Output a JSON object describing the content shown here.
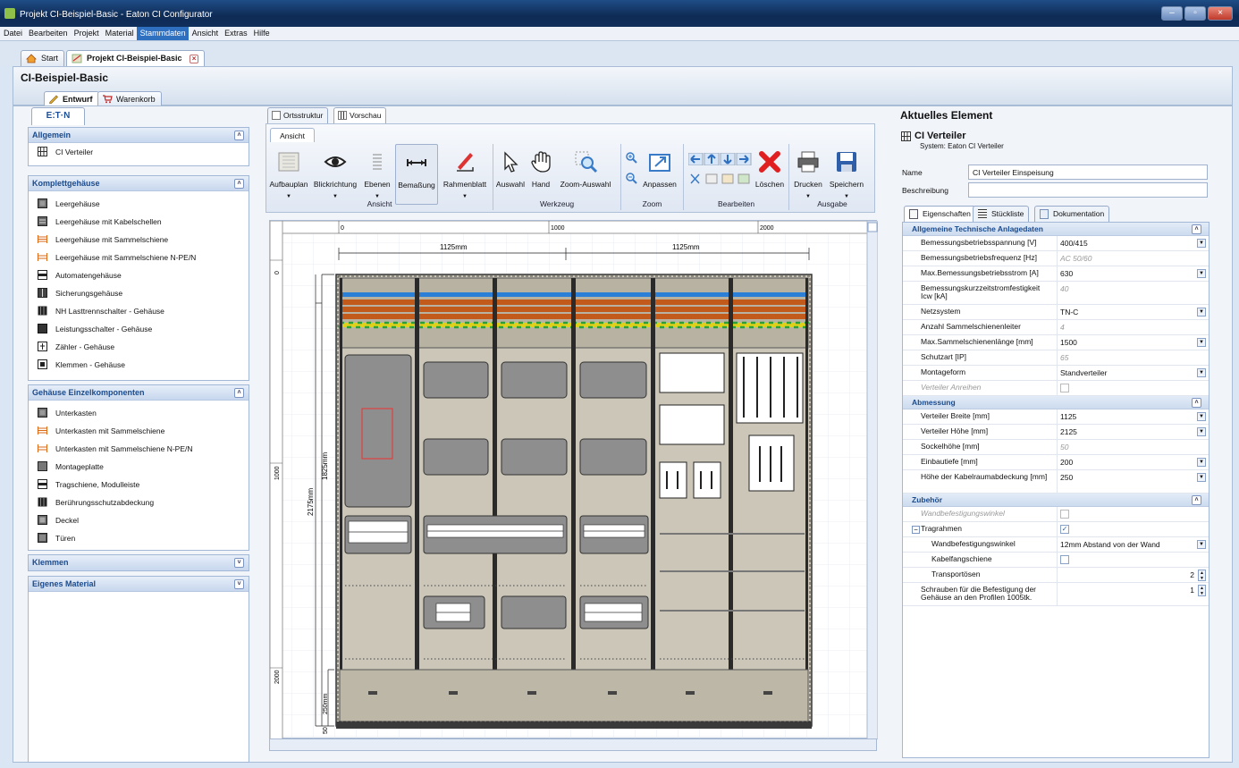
{
  "window": {
    "title": "Projekt CI-Beispiel-Basic - Eaton CI Configurator"
  },
  "menu": [
    "Datei",
    "Bearbeiten",
    "Projekt",
    "Material",
    "Stammdaten",
    "Ansicht",
    "Extras",
    "Hilfe"
  ],
  "doc_tabs": [
    "Start",
    "Projekt CI-Beispiel-Basic"
  ],
  "project": {
    "title": "CI-Beispiel-Basic",
    "tabs": [
      "Entwurf",
      "Warenkorb"
    ]
  },
  "left": {
    "logo": "E:T·N",
    "sections": [
      {
        "title": "Allgemein",
        "items": [
          "CI Verteiler"
        ]
      },
      {
        "title": "Komplettgehäuse",
        "items": [
          "Leergehäuse",
          "Leergehäuse mit Kabelschellen",
          "Leergehäuse mit Sammelschiene",
          "Leergehäuse mit Sammelschiene N-PE/N",
          "Automatengehäuse",
          "Sicherungsgehäuse",
          "NH Lasttrennschalter - Gehäuse",
          "Leistungsschalter - Gehäuse",
          "Zähler - Gehäuse",
          "Klemmen - Gehäuse"
        ]
      },
      {
        "title": "Gehäuse Einzelkomponenten",
        "items": [
          "Unterkasten",
          "Unterkasten mit Sammelschiene",
          "Unterkasten mit Sammelschiene N-PE/N",
          "Montageplatte",
          "Tragschiene, Modulleiste",
          "Berührungsschutzabdeckung",
          "Deckel",
          "Türen"
        ]
      },
      {
        "title": "Klemmen",
        "items": []
      },
      {
        "title": "Eigenes Material",
        "items": []
      }
    ]
  },
  "center": {
    "view_tabs": [
      "Ortsstruktur",
      "Vorschau"
    ],
    "ribbon_tab": "Ansicht",
    "buttons": {
      "aufbauplan": "Aufbauplan",
      "blickrichtung": "Blickrichtung",
      "ebenen": "Ebenen",
      "bemassung": "Bemaßung",
      "rahmenblatt": "Rahmenblatt",
      "auswahl": "Auswahl",
      "hand": "Hand",
      "zoom_auswahl": "Zoom-Auswahl",
      "anpassen": "Anpassen",
      "loeschen": "Löschen",
      "drucken": "Drucken",
      "speichern": "Speichern"
    },
    "groups": {
      "ansicht": "Ansicht",
      "werkzeug": "Werkzeug",
      "zoom": "Zoom",
      "bearbeiten": "Bearbeiten",
      "ausgabe": "Ausgabe"
    },
    "drawing": {
      "ruler_top": [
        "0",
        "1000",
        "2000"
      ],
      "ruler_left": [
        "0",
        "1000",
        "2000"
      ],
      "dim_left_width": "1125mm",
      "dim_right_width": "1125mm",
      "dim_total_height": "2175mm",
      "dim_upper_height": "1825mm",
      "dim_lower_height": "250mm",
      "dim_bottom": "50"
    }
  },
  "right": {
    "title": "Aktuelles Element",
    "element_name": "CI Verteiler",
    "element_system": "System: Eaton CI Verteiler",
    "name_label": "Name",
    "name_value": "CI Verteiler Einspeisung",
    "desc_label": "Beschreibung",
    "desc_value": "",
    "tabs": [
      "Eigenschaften",
      "Stückliste",
      "Dokumentation"
    ],
    "sections": [
      {
        "title": "Allgemeine Technische Anlagedaten",
        "rows": [
          {
            "k": "Bemessungsbetriebsspannung [V]",
            "v": "400/415",
            "t": "dd"
          },
          {
            "k": "Bemessungsbetriebsfrequenz [Hz]",
            "v": "AC 50/60",
            "t": "dis"
          },
          {
            "k": "Max.Bemessungsbetriebsstrom [A]",
            "v": "630",
            "t": "dd"
          },
          {
            "k": "Bemessungskurzzeitstromfestigkeit Icw [kA]",
            "v": "40",
            "t": "dis",
            "tall": true
          },
          {
            "k": "Netzsystem",
            "v": "TN-C",
            "t": "dd"
          },
          {
            "k": "Anzahl Sammelschienenleiter",
            "v": "4",
            "t": "dis"
          },
          {
            "k": "Max.Sammelschienenlänge [mm]",
            "v": "1500",
            "t": "dd"
          },
          {
            "k": "Schutzart [IP]",
            "v": "65",
            "t": "dis"
          },
          {
            "k": "Montageform",
            "v": "Standverteiler",
            "t": "dd"
          },
          {
            "k": "Verteiler Anreihen",
            "v": "",
            "t": "chkdis"
          }
        ]
      },
      {
        "title": "Abmessung",
        "rows": [
          {
            "k": "Verteiler Breite [mm]",
            "v": "1125",
            "t": "dd"
          },
          {
            "k": "Verteiler Höhe [mm]",
            "v": "2125",
            "t": "dd"
          },
          {
            "k": "Sockelhöhe [mm]",
            "v": "50",
            "t": "dis"
          },
          {
            "k": "Einbautiefe [mm]",
            "v": "200",
            "t": "dd"
          },
          {
            "k": "Höhe der Kabelraumabdeckung [mm]",
            "v": "250",
            "t": "dd",
            "tall": true
          }
        ]
      },
      {
        "title": "Zubehör",
        "rows": [
          {
            "k": "Wandbefestigungswinkel",
            "v": "",
            "t": "chkdis"
          },
          {
            "k": "Tragrahmen",
            "v": "✓",
            "t": "chk",
            "expander": true
          },
          {
            "k": "Wandbefestigungswinkel",
            "v": "12mm Abstand von der Wand",
            "t": "dd",
            "indent": true
          },
          {
            "k": "Kabelfangschiene",
            "v": "",
            "t": "chk",
            "indent": true
          },
          {
            "k": "Transportösen",
            "v": "2",
            "t": "spin",
            "indent": true
          },
          {
            "k": "Schrauben für die Befestigung der Gehäuse an den Profilen 1005tk.",
            "v": "1",
            "t": "spin",
            "tall": true
          }
        ]
      }
    ]
  },
  "colors": {
    "accent": "#2f6fc0",
    "header": "#1a4a8e",
    "cabinet": "#c9c3b5",
    "module": "#8c8c8c"
  }
}
